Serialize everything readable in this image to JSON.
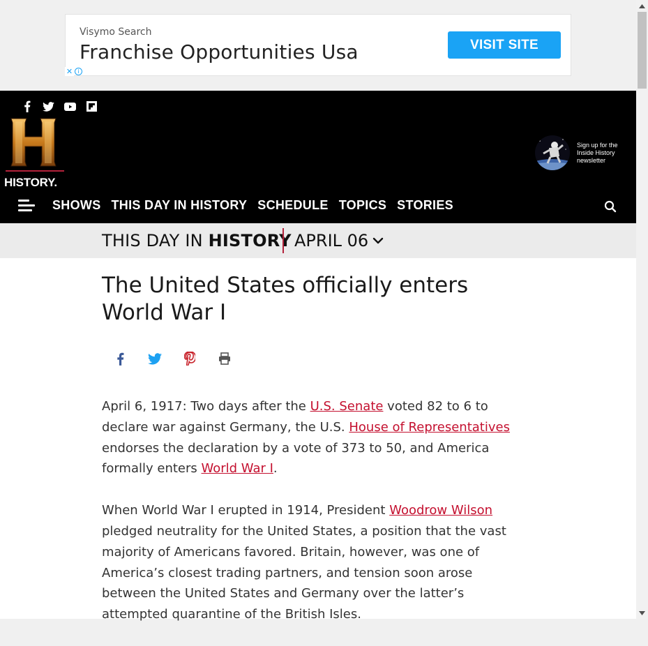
{
  "ad": {
    "sponsor": "Visymo Search",
    "title": "Franchise Opportunities Usa",
    "cta": "VISIT SITE",
    "close_glyph": "✕",
    "info_glyph": "i"
  },
  "header": {
    "social_icons": [
      "facebook-icon",
      "twitter-icon",
      "youtube-icon",
      "flipboard-icon"
    ],
    "logo_text": "HISTORY",
    "logo_trademark": ".",
    "newsletter_text": "Sign up for the Inside History newsletter",
    "nav": [
      "SHOWS",
      "THIS DAY IN HISTORY",
      "SCHEDULE",
      "TOPICS",
      "STORIES"
    ]
  },
  "daybar": {
    "prefix": "THIS DAY IN ",
    "brand": "HISTORY",
    "date": "APRIL 06"
  },
  "article": {
    "headline": "The United States officially enters World War I",
    "p1": {
      "t1": "April 6, 1917: Two days after the ",
      "link1": "U.S. Senate",
      "t2": " voted 82 to 6 to declare war against Germany, the U.S. ",
      "link2": "House of Representatives",
      "t3": " endorses the declaration by a vote of 373 to 50, and America formally enters ",
      "link3": "World War I",
      "t4": "."
    },
    "p2": {
      "t1": "When World War I erupted in 1914, President ",
      "link1": "Woodrow Wilson",
      "t2": " pledged neutrality for the United States, a position that the vast majority of Americans favored. Britain, however, was one of America’s closest trading partners, and tension soon arose between the United States and Germany over the latter’s attempted quarantine of the British Isles."
    }
  },
  "colors": {
    "accent": "#c4102f",
    "ad_button": "#1aa3f5",
    "header_bg": "#000000",
    "facebook": "#3b5998",
    "twitter": "#1da1f2",
    "pinterest": "#c8232c"
  }
}
